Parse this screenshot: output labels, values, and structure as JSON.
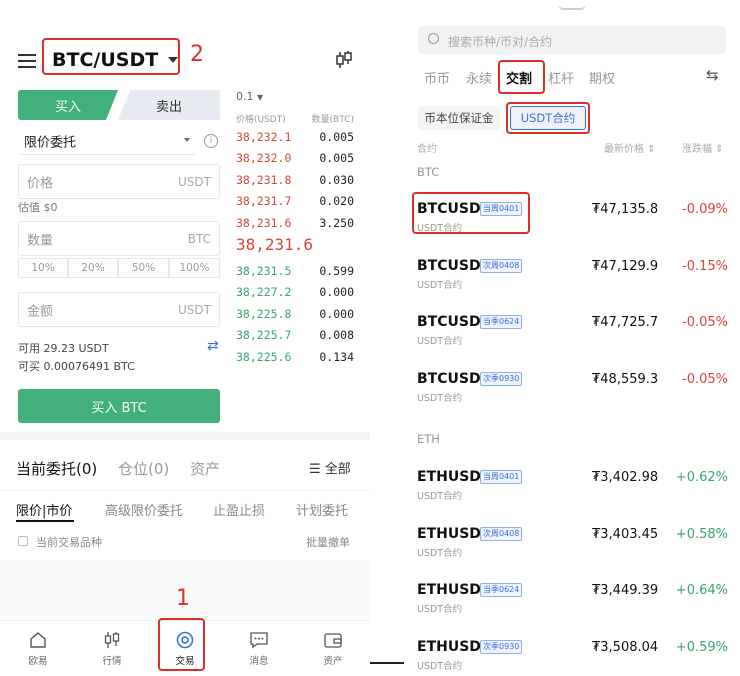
{
  "left": {
    "pair": "BTC/USDT",
    "annotation_pair": "2",
    "annotation_nav": "1",
    "tab_buy": "买入",
    "tab_sell": "卖出",
    "order_type": "限价委托",
    "price_placeholder": "价格",
    "price_unit": "USDT",
    "estimate": "估值 $0",
    "qty_placeholder": "数量",
    "qty_unit": "BTC",
    "percents": [
      "10%",
      "20%",
      "50%",
      "100%"
    ],
    "amount_placeholder": "金额",
    "amount_unit": "USDT",
    "available": "可用 29.23 USDT",
    "can_buy": "可买 0.00076491 BTC",
    "buy_button": "买入 BTC",
    "orderbook": {
      "precision": "0.1",
      "col_price": "价格(USDT)",
      "col_qty": "数量(BTC)",
      "asks": [
        {
          "price": "38,232.1",
          "qty": "0.005"
        },
        {
          "price": "38,232.0",
          "qty": "0.005"
        },
        {
          "price": "38,231.8",
          "qty": "0.030"
        },
        {
          "price": "38,231.7",
          "qty": "0.020"
        },
        {
          "price": "38,231.6",
          "qty": "3.250"
        }
      ],
      "last_price": "38,231.6",
      "bids": [
        {
          "price": "38,231.5",
          "qty": "0.599"
        },
        {
          "price": "38,227.2",
          "qty": "0.000"
        },
        {
          "price": "38,225.8",
          "qty": "0.000"
        },
        {
          "price": "38,225.7",
          "qty": "0.008"
        },
        {
          "price": "38,225.6",
          "qty": "0.134"
        }
      ]
    },
    "order_tabs": {
      "current": "当前委托(0)",
      "positions": "仓位(0)",
      "assets": "资产",
      "all": "全部"
    },
    "sub_tabs": [
      "限价|市价",
      "高级限价委托",
      "止盈止损",
      "计划委托"
    ],
    "current_pair_filter": "当前交易品种",
    "batch_cancel": "批量撤单",
    "nav": [
      "欧易",
      "行情",
      "交易",
      "消息",
      "资产"
    ]
  },
  "right": {
    "search_placeholder": "搜索币种/币对/合约",
    "tabs": [
      "币币",
      "永续",
      "交割",
      "杠杆",
      "期权"
    ],
    "segments": [
      "币本位保证金",
      "USDT合约"
    ],
    "col_contract": "合约",
    "col_price": "最新价格 ⇕",
    "col_change": "涨跌幅 ⇕",
    "groups": [
      {
        "name": "BTC",
        "rows": [
          {
            "symbol": "BTCUSDT",
            "badge": "当周0401",
            "sub": "USDT合约",
            "price": "₮47,135.8",
            "change": "-0.09%"
          },
          {
            "symbol": "BTCUSDT",
            "badge": "次周0408",
            "sub": "USDT合约",
            "price": "₮47,129.9",
            "change": "-0.15%"
          },
          {
            "symbol": "BTCUSDT",
            "badge": "当季0624",
            "sub": "USDT合约",
            "price": "₮47,725.7",
            "change": "-0.05%"
          },
          {
            "symbol": "BTCUSDT",
            "badge": "次季0930",
            "sub": "USDT合约",
            "price": "₮48,559.3",
            "change": "-0.05%"
          }
        ]
      },
      {
        "name": "ETH",
        "rows": [
          {
            "symbol": "ETHUSDT",
            "badge": "当周0401",
            "sub": "USDT合约",
            "price": "₮3,402.98",
            "change": "+0.62%"
          },
          {
            "symbol": "ETHUSDT",
            "badge": "次周0408",
            "sub": "USDT合约",
            "price": "₮3,403.45",
            "change": "+0.58%"
          },
          {
            "symbol": "ETHUSDT",
            "badge": "当季0624",
            "sub": "USDT合约",
            "price": "₮3,449.39",
            "change": "+0.64%"
          },
          {
            "symbol": "ETHUSDT",
            "badge": "次季0930",
            "sub": "USDT合约",
            "price": "₮3,508.04",
            "change": "+0.59%"
          }
        ]
      }
    ],
    "colors": {
      "up": "#3ba46e",
      "down": "#d9453a",
      "accent": "#3b6fd9",
      "highlight": "#d9302a"
    }
  }
}
